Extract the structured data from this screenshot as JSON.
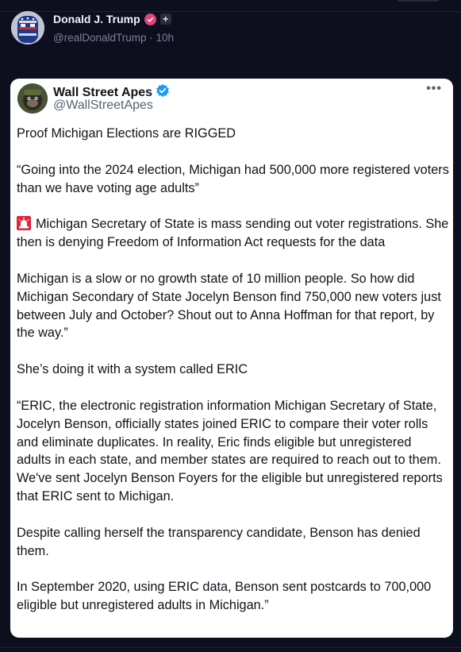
{
  "post": {
    "author_name": "Donald J. Trump",
    "handle_time": "@realDonaldTrump · 10h",
    "badge_icon": "verified-pink-icon",
    "plus_label": "+"
  },
  "quote": {
    "author_name": "Wall Street Apes",
    "handle": "@WallStreetApes",
    "more_label": "•••",
    "paragraphs": [
      "Proof Michigan Elections are RIGGED",
      "“Going into the 2024 election, Michigan had 500,000 more registered voters than we have voting age adults”",
      "Michigan Secretary of State is mass sending out voter registrations. She then is denying Freedom of Information Act requests for the data",
      "Michigan is a slow or no growth state of 10 million people. So how did Michigan Secondary of State Jocelyn Benson find 750,000 new voters just between July and October? Shout out to Anna Hoffman for that report, by the way.”",
      "She’s doing it with a system called ERIC",
      "“ERIC, the electronic registration information Michigan Secretary of State, Jocelyn Benson, officially states joined ERIC to compare their voter rolls and eliminate duplicates. In reality, Eric finds eligible but unregistered adults in each state, and member states are required to reach out to them. We've sent Jocelyn Benson Foyers for the eligible but unregistered reports that ERIC sent to Michigan.",
      "Despite calling herself the transparency candidate, Benson has denied them.",
      "In September 2020, using ERIC data, Benson sent postcards to 700,000 eligible but unregistered adults in Michigan.”"
    ]
  },
  "colors": {
    "background": "#0d0f1e",
    "card": "#ffffff",
    "verified_blue": "#1d9bf0",
    "verified_pink": "#e0457c",
    "siren_red": "#e0243a"
  }
}
